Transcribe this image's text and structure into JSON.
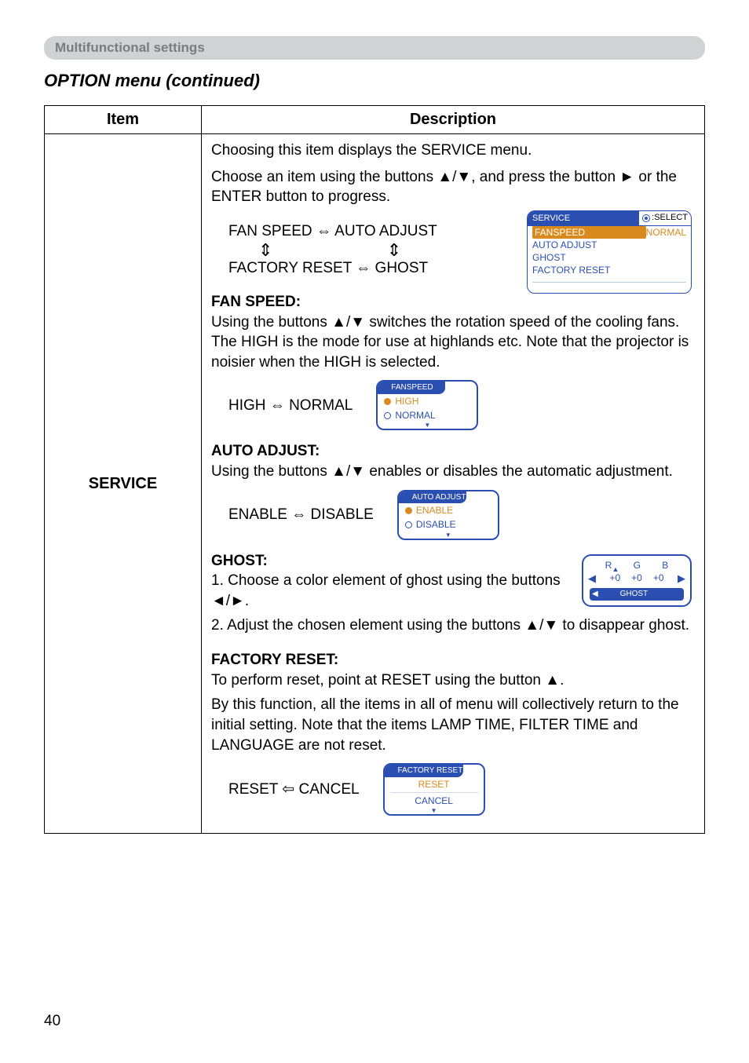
{
  "section_bar": "Multifunctional settings",
  "menu_title": "OPTION menu (continued)",
  "table": {
    "header_item": "Item",
    "header_desc": "Description",
    "item_label": "SERVICE"
  },
  "intro": {
    "line1": "Choosing this item displays the SERVICE menu.",
    "line2": "Choose an item using the buttons ▲/▼, and press the button ► or the ENTER button to progress."
  },
  "service_nav": {
    "row1_left": "FAN SPEED",
    "row1_mid": "⇔",
    "row1_right": "AUTO ADJUST",
    "row2_left": "FACTORY RESET",
    "row2_mid": "⇔",
    "row2_right": "GHOST"
  },
  "service_osd": {
    "hdr_left": "SERVICE",
    "hdr_right": ":SELECT",
    "rows": [
      {
        "l": "FANSPEED",
        "r": "NORMAL",
        "sel": true
      },
      {
        "l": "AUTO ADJUST",
        "r": ""
      },
      {
        "l": "GHOST",
        "r": ""
      },
      {
        "l": "FACTORY RESET",
        "r": ""
      }
    ]
  },
  "fan": {
    "heading": "FAN SPEED:",
    "body": "Using the buttons ▲/▼ switches the rotation speed of the cooling fans. The HIGH is the mode for use at highlands etc. Note that the projector is noisier when the HIGH is selected.",
    "toggle_left": "HIGH",
    "toggle_mid": "⇔",
    "toggle_right": "NORMAL",
    "pill_hdr": "FANSPEED",
    "pill_opt1": "HIGH",
    "pill_opt2": "NORMAL"
  },
  "auto": {
    "heading": "AUTO ADJUST:",
    "body": "Using the buttons ▲/▼ enables or disables the automatic adjustment.",
    "toggle_left": "ENABLE",
    "toggle_mid": "⇔",
    "toggle_right": "DISABLE",
    "pill_hdr": "AUTO ADJUST",
    "pill_opt1": "ENABLE",
    "pill_opt2": "DISABLE"
  },
  "ghost": {
    "heading": "GHOST:",
    "step1": "1. Choose a color element of ghost using the buttons ◄/►.",
    "step2": "2. Adjust the chosen element using the buttons ▲/▼ to disappear ghost.",
    "osd": {
      "r": "R",
      "g": "G",
      "b": "B",
      "v": "+0",
      "foot": "GHOST"
    }
  },
  "factory": {
    "heading": "FACTORY RESET:",
    "line1": "To perform reset, point at RESET using the button ▲.",
    "line2": "By this function, all the items in all of menu will collectively return to the initial setting. Note that the items LAMP TIME, FILTER TIME and LANGUAGE are not reset.",
    "toggle_left": "RESET",
    "toggle_mid": "⇦",
    "toggle_right": "CANCEL",
    "pill_hdr": "FACTORY RESET",
    "pill_opt1": "RESET",
    "pill_opt2": "CANCEL"
  },
  "page_number": "40"
}
